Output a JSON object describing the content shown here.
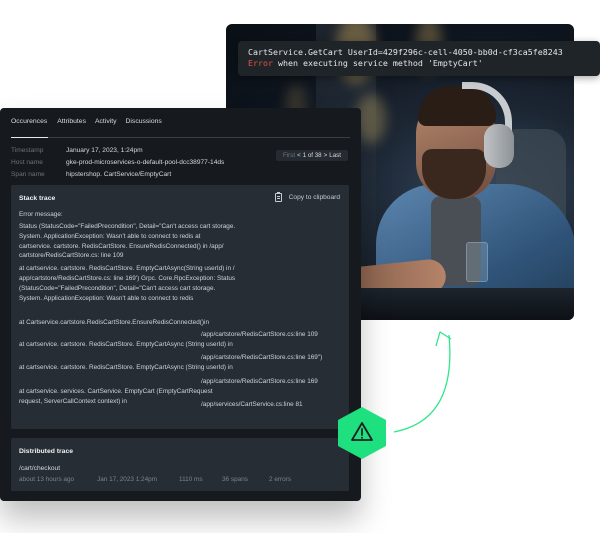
{
  "code_snippet": {
    "line1": "CartService.GetCart UserId=429f296c-cell-4050-bb0d-cf3ca5fe8243",
    "line2_error_word": "Error",
    "line2_rest": " when executing service method 'EmptyCart'",
    "error_color": "#e5534b"
  },
  "panel": {
    "tabs": [
      {
        "label": "Occurences",
        "active": true
      },
      {
        "label": "Attributes",
        "active": false
      },
      {
        "label": "Activity",
        "active": false
      },
      {
        "label": "Discussions",
        "active": false
      }
    ],
    "meta": [
      {
        "label": "Timestamp",
        "value": "January 17, 2023, 1:24pm"
      },
      {
        "label": "Host name",
        "value": "gke-prod-microservices-o-default-pool-dcc38977-14ds"
      },
      {
        "label": "Span name",
        "value": "hipstershop. CartService/EmptyCart"
      }
    ],
    "pager": {
      "first": "First",
      "prev": "<",
      "position": "1 of 38",
      "next": ">",
      "last": "Last"
    },
    "stack_trace": {
      "title": "Stack trace",
      "copy_label": "Copy to clipboard",
      "error_heading": "Error message:",
      "message_lines": [
        "Status (StatusCode=\"FailedPrecondition\", Detail=\"Can't access cart storage.",
        "System. ApplicationException: Wasn't able to connect to redis at",
        "cartservice. cartstore. RedisCartStore. EnsureRedisConnected() in /app/",
        "cartstore/RedisCartStore.cs: line 109"
      ],
      "block2_lines": [
        "at cartservice. cartstore. RedisCartStore. EmptyCartAsync(String userId) in /",
        "app/cartstore/RedisCartStore.cs: line 169') Grpc. Core.RpcException: Status",
        "(StatusCode=\"FailedPrecondition\", Detail=\"Can't access cart storage.",
        "System. ApplicationException: Wasn't able to connect to redis"
      ],
      "frames": [
        {
          "call": "at Cartservice.cartstore.RedisCartStore.EnsureRedisConnected()in",
          "location": "/app/cartstore/RedisCartStore.cs:line 109"
        },
        {
          "call": "at cartservice. cartstore. RedisCartStore. EmptyCartAsync (String userId) in",
          "location": "/app/cartstore/RedisCartStore.cs:line 169\")"
        },
        {
          "call": "at cartservice. cartstore. RedisCartStore. EmptyCartAsync (String userId) in",
          "location": "/app/cartstore/RedisCartStore.cs:line 169"
        },
        {
          "call": "at cartservice. services. CartService. EmptyCart (EmptyCartRequest",
          "call2": "request, ServerCallContext context) in",
          "location": "/app/services/CartService.cs:line 81"
        }
      ]
    },
    "distributed_trace": {
      "title": "Distributed trace",
      "path": "/cart/checkout",
      "relative_time": "about 13 hours ago",
      "timestamp": "Jan 17, 2023 1:24pm",
      "duration": "1110 ms",
      "spans": "36 spans",
      "errors": "2 errors"
    }
  },
  "badge": {
    "icon": "warning-icon",
    "color": "#1fe07e"
  },
  "photo": {
    "description": "man-with-headphones-at-computer"
  }
}
